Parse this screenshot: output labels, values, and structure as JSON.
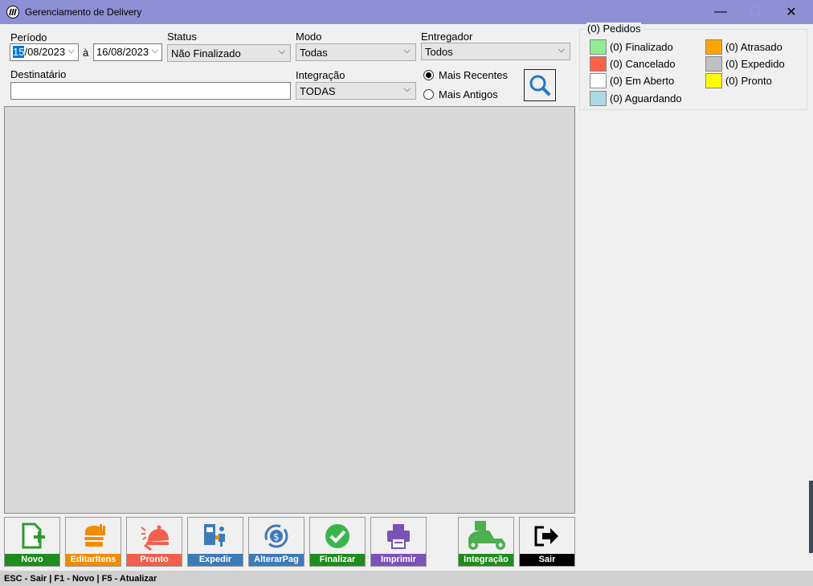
{
  "window": {
    "title": "Gerenciamento de Delivery",
    "min": "—",
    "max": "☐",
    "close": "✕"
  },
  "filters": {
    "periodo_label": "Período",
    "date_start": "15/08/2023",
    "date_start_sel": "15",
    "date_start_rest": "/08/2023",
    "date_sep": "à",
    "date_end": "16/08/2023",
    "status_label": "Status",
    "status_value": "Não Finalizado",
    "modo_label": "Modo",
    "modo_value": "Todas",
    "entregador_label": "Entregador",
    "entregador_value": "Todos",
    "destinatario_label": "Destinatário",
    "destinatario_value": "",
    "integracao_label": "Integração",
    "integracao_value": "TODAS",
    "order_recent": "Mais Recentes",
    "order_old": "Mais Antigos",
    "search_icon": "search-icon"
  },
  "legend": {
    "title": "(0) Pedidos",
    "items": [
      {
        "label": "(0) Finalizado",
        "color": "#90ee90"
      },
      {
        "label": "(0) Atrasado",
        "color": "#ffa500"
      },
      {
        "label": "(0) Cancelado",
        "color": "#ff6347"
      },
      {
        "label": "(0) Expedido",
        "color": "#c0c0c0"
      },
      {
        "label": "(0) Em Aberto",
        "color": "#ffffff"
      },
      {
        "label": "(0) Pronto",
        "color": "#ffff00"
      },
      {
        "label": "(0) Aguardando",
        "color": "#add8e6"
      }
    ]
  },
  "toolbar": [
    {
      "label": "Novo",
      "color": "#1e8c1e",
      "icon": "new-document-icon"
    },
    {
      "label": "EditarItens",
      "color": "#f08c00",
      "icon": "food-icon"
    },
    {
      "label": "Pronto",
      "color": "#f0604c",
      "icon": "bell-icon"
    },
    {
      "label": "Expedir",
      "color": "#3d7ab8",
      "icon": "dispatch-icon"
    },
    {
      "label": "AlterarPag",
      "color": "#3d7ab8",
      "icon": "payment-icon"
    },
    {
      "label": "Finalizar",
      "color": "#1e8c1e",
      "icon": "check-icon"
    },
    {
      "label": "Imprimir",
      "color": "#7a52b8",
      "icon": "printer-icon"
    },
    {
      "label": "Integração",
      "color": "#1e8c1e",
      "icon": "delivery-scooter-icon"
    },
    {
      "label": "Sair",
      "color": "#000000",
      "icon": "exit-icon"
    }
  ],
  "statusbar": {
    "text": "ESC - Sair | F1 - Novo | F5 - Atualizar"
  }
}
